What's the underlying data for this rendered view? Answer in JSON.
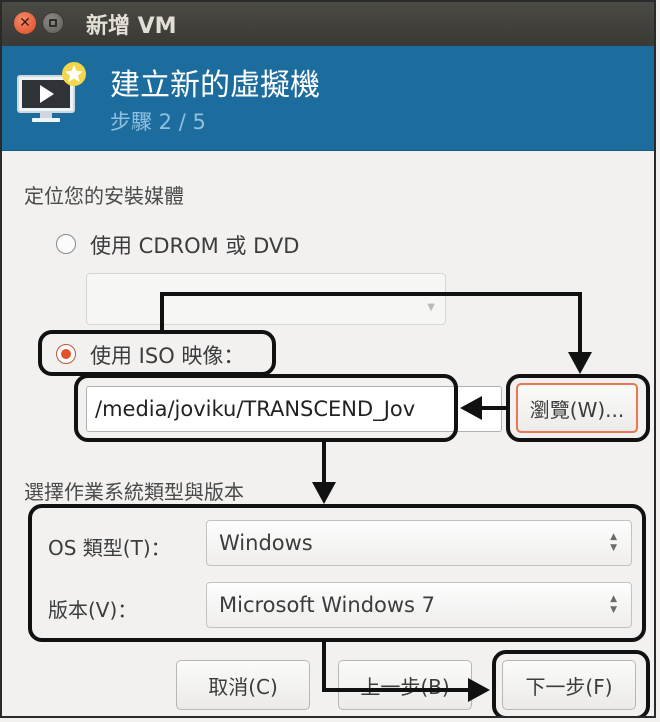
{
  "window": {
    "title": "新增 VM"
  },
  "icons": {
    "close": "close-icon",
    "minimize": "minimize-icon",
    "monitor": "monitor-play-icon",
    "new": "star-badge-icon",
    "dropdown": "dropdown-arrow-icon",
    "spinner": "spinner-arrows-icon"
  },
  "header": {
    "title": "建立新的虛擬機",
    "step": "步驟 2 / 5"
  },
  "install_media": {
    "section_label": "定位您的安裝媒體",
    "cdrom_label": "使用 CDROM 或 DVD",
    "cdrom_selected": false,
    "cdrom_value": "",
    "iso_label": "使用 ISO 映像：",
    "iso_selected": true,
    "iso_path": "/media/joviku/TRANSCEND_Jov",
    "browse_label": "瀏覽(W)..."
  },
  "os": {
    "section_label": "選擇作業系統類型與版本",
    "type_label": "OS 類型(T)：",
    "type_value": "Windows",
    "version_label": "版本(V)：",
    "version_value": "Microsoft Windows 7"
  },
  "buttons": {
    "cancel": "取消(C)",
    "back": "上一步(B)",
    "forward": "下一步(F)"
  },
  "colors": {
    "banner": "#1d6c9e",
    "titlebar": "#3f3e39",
    "radio_active": "#e0512c",
    "browse_highlight": "#e8784f",
    "annotation": "#111111"
  }
}
